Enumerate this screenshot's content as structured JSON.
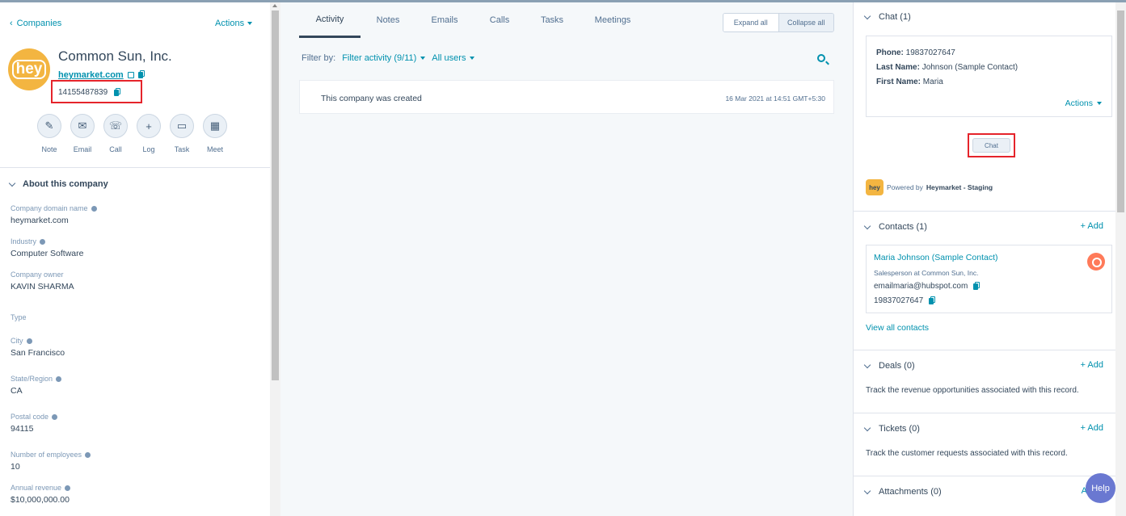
{
  "left": {
    "back_label": "Companies",
    "actions_label": "Actions",
    "logo_text": "hey",
    "company_name": "Common Sun, Inc.",
    "domain": "heymarket.com",
    "phone": "14155487839",
    "action_buttons": [
      {
        "label": "Note",
        "icon": "✎"
      },
      {
        "label": "Email",
        "icon": "✉"
      },
      {
        "label": "Call",
        "icon": "☏"
      },
      {
        "label": "Log",
        "icon": "+"
      },
      {
        "label": "Task",
        "icon": "▭"
      },
      {
        "label": "Meet",
        "icon": "▦"
      }
    ],
    "about_title": "About this company",
    "properties": [
      {
        "label": "Company domain name",
        "value": "heymarket.com"
      },
      {
        "label": "Industry",
        "value": "Computer Software"
      },
      {
        "label": "Company owner",
        "value": "KAVIN SHARMA"
      },
      {
        "label": "Type",
        "value": ""
      },
      {
        "label": "City",
        "value": "San Francisco"
      },
      {
        "label": "State/Region",
        "value": "CA"
      },
      {
        "label": "Postal code",
        "value": "94115"
      },
      {
        "label": "Number of employees",
        "value": "10"
      },
      {
        "label": "Annual revenue",
        "value": "$10,000,000.00"
      }
    ]
  },
  "middle": {
    "tabs": [
      "Activity",
      "Notes",
      "Emails",
      "Calls",
      "Tasks",
      "Meetings"
    ],
    "expand_all": "Expand all",
    "collapse_all": "Collapse all",
    "filter_by": "Filter by:",
    "filter_activity": "Filter activity (9/11)",
    "all_users": "All users",
    "event_text": "This company was created",
    "event_date": "16 Mar 2021 at 14:51 GMT+5:30"
  },
  "right": {
    "chat_title": "Chat (1)",
    "chat_phone_label": "Phone:",
    "chat_phone": "19837027647",
    "chat_last_label": "Last Name:",
    "chat_last": "Johnson (Sample Contact)",
    "chat_first_label": "First Name:",
    "chat_first": "Maria",
    "chat_actions": "Actions",
    "chat_button": "Chat",
    "powered_prefix": "Powered by",
    "powered_brand": "Heymarket - Staging",
    "contacts_title": "Contacts (1)",
    "add_label": "+ Add",
    "contact_name": "Maria Johnson (Sample Contact)",
    "contact_role": "Salesperson at Common Sun, Inc.",
    "contact_email": "emailmaria@hubspot.com",
    "contact_phone": "19837027647",
    "view_all": "View all contacts",
    "deals_title": "Deals (0)",
    "deals_text": "Track the revenue opportunities associated with this record.",
    "tickets_title": "Tickets (0)",
    "tickets_text": "Track the customer requests associated with this record.",
    "attachments_title": "Attachments (0)",
    "attachments_add": "A",
    "help_label": "Help"
  }
}
